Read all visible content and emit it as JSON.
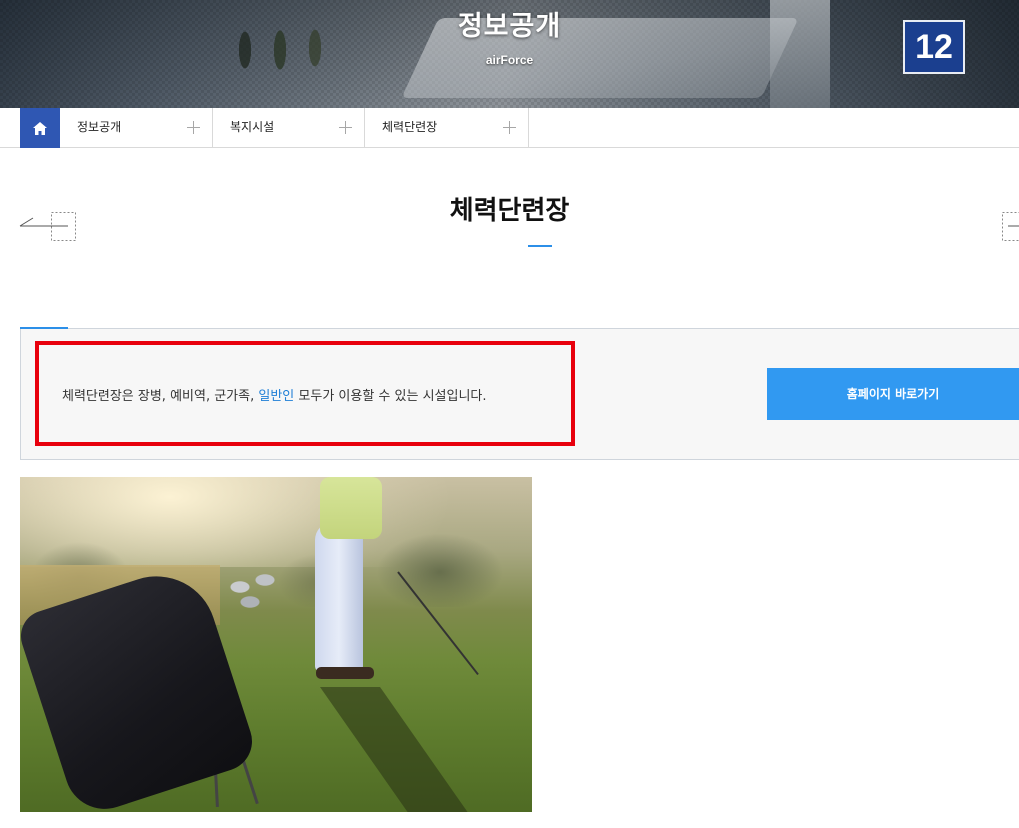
{
  "hero": {
    "title": "정보공개",
    "subtitle": "airForce",
    "badge_number": "12"
  },
  "location": {
    "home_icon": "home-icon",
    "items": [
      {
        "label": "정보공개"
      },
      {
        "label": "복지시설"
      },
      {
        "label": "체력단련장"
      }
    ]
  },
  "page": {
    "title": "체력단련장"
  },
  "info": {
    "text_before": "체력단련장은 장병, 예비역, 군가족, ",
    "text_highlight": "일반인",
    "text_after": " 모두가 이용할 수 있는 시설입니다.",
    "button_label": "홈페이지 바로가기"
  },
  "colors": {
    "accent_blue": "#2c8fe8",
    "home_blue": "#2f57b3",
    "button_blue": "#3199f1",
    "highlight_red": "#e8000d"
  }
}
